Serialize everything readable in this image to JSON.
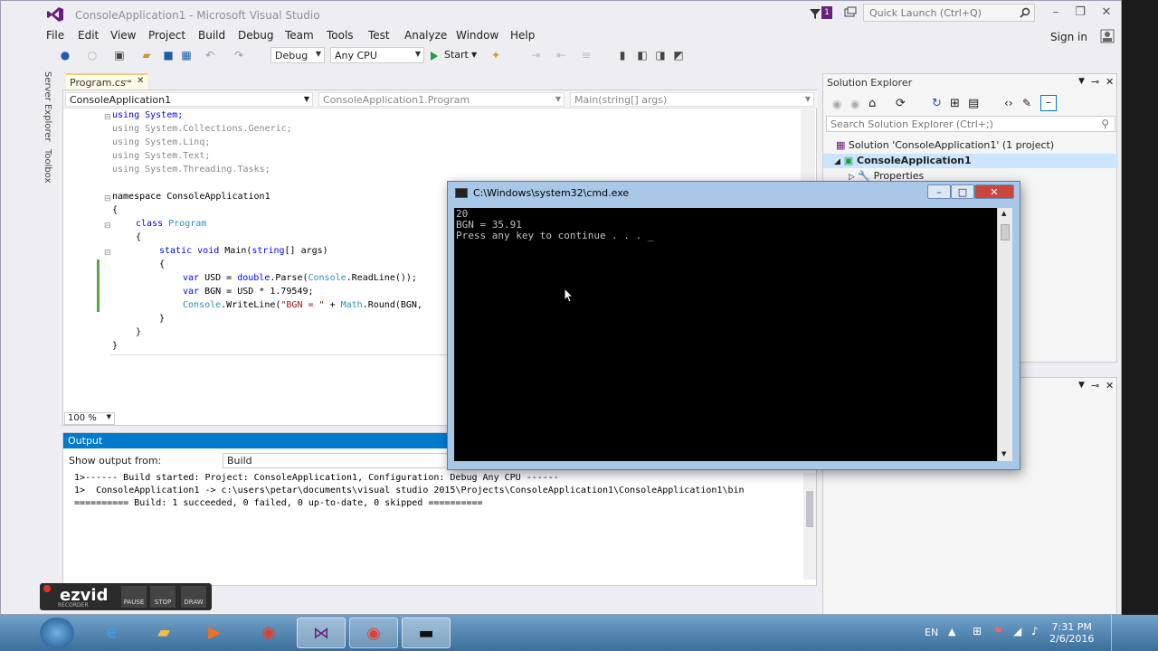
{
  "titlebar": {
    "title": "ConsoleApplication1 - Microsoft Visual Studio",
    "quick_launch_placeholder": "Quick Launch (Ctrl+Q)",
    "notif_count": "1"
  },
  "menu": [
    "File",
    "Edit",
    "View",
    "Project",
    "Build",
    "Debug",
    "Team",
    "Tools",
    "Test",
    "Analyze",
    "Window",
    "Help"
  ],
  "signin": "Sign in",
  "toolbar": {
    "config": "Debug",
    "platform": "Any CPU",
    "start": "Start"
  },
  "sidetabs": [
    "Server Explorer",
    "Toolbox"
  ],
  "doc_tab": "Program.cs",
  "navbar": {
    "project": "ConsoleApplication1",
    "class": "ConsoleApplication1.Program",
    "member": "Main(string[] args)"
  },
  "code": {
    "l1": "using System;",
    "l2": "using System.Collections.Generic;",
    "l3": "using System.Linq;",
    "l4": "using System.Text;",
    "l5": "using System.Threading.Tasks;",
    "l6": "namespace ConsoleApplication1",
    "l7": "{",
    "l8a": "class",
    "l8b": "Program",
    "l9": "{",
    "l10a": "static",
    "l10b": "void",
    "l10c": "Main(",
    "l10d": "string",
    "l10e": "[] args)",
    "l11": "{",
    "l12a": "var",
    "l12b": "USD = ",
    "l12c": "double",
    "l12d": ".Parse(",
    "l12e": "Console",
    "l12f": ".ReadLine());",
    "l13a": "var",
    "l13b": "BGN = USD * 1.79549;",
    "l14a": "Console",
    "l14b": ".WriteLine(",
    "l14c": "\"BGN = \"",
    "l14d": " + ",
    "l14e": "Math",
    "l14f": ".Round(BGN,",
    "l15": "}",
    "l16": "}",
    "l17": "}"
  },
  "zoom": "100 %",
  "output": {
    "title": "Output",
    "show_from_label": "Show output from:",
    "source": "Build",
    "lines": [
      "1>------ Build started: Project: ConsoleApplication1, Configuration: Debug Any CPU ------",
      "1>  ConsoleApplication1 -> c:\\users\\petar\\documents\\visual studio 2015\\Projects\\ConsoleApplication1\\ConsoleApplication1\\bin",
      "========== Build: 1 succeeded, 0 failed, 0 up-to-date, 0 skipped =========="
    ]
  },
  "solution_explorer": {
    "title": "Solution Explorer",
    "search_placeholder": "Search Solution Explorer (Ctrl+;)",
    "solution": "Solution 'ConsoleApplication1' (1 project)",
    "project": "ConsoleApplication1",
    "properties": "Properties"
  },
  "cmd": {
    "title": "C:\\Windows\\system32\\cmd.exe",
    "lines": [
      "20",
      "BGN = 35.91",
      "Press any key to continue . . . _"
    ]
  },
  "ezvid": {
    "logo": "ezvid",
    "sub": "RECORDER",
    "buttons": [
      "PAUSE",
      "STOP",
      "DRAW"
    ]
  },
  "taskbar": {
    "lang": "EN",
    "time": "7:31 PM",
    "date": "2/6/2016"
  },
  "colors": {
    "accent": "#007acc",
    "console_bg": "#000000",
    "taskbar": "#4a7fae"
  }
}
